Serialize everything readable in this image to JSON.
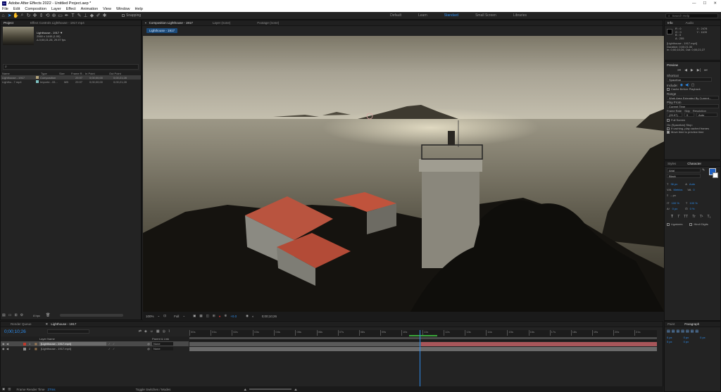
{
  "app": {
    "title": "Adobe After Effects 2022 - Untitled Project.aep *",
    "menu": [
      "File",
      "Edit",
      "Composition",
      "Layer",
      "Effect",
      "Animation",
      "View",
      "Window",
      "Help"
    ]
  },
  "toolbar": {
    "snapping_label": "Snapping",
    "workspaces": [
      "Default",
      "Learn",
      "Standard",
      "Small Screen",
      "Libraries"
    ],
    "active_workspace": "Standard",
    "search_placeholder": "Search Help"
  },
  "project": {
    "tab_label": "Project",
    "effect_controls_label": "Effect Controls Lighthouse - 1917.mp4",
    "preview_name": "Lighthouse - 1917 ▼",
    "preview_line1": "2560 x 1440 (1.00)",
    "preview_line2": "Δ 0;00;21;28, 29.97 fps",
    "columns": [
      "Name",
      "Type",
      "Size",
      "Frame R...",
      "In Point",
      "Out Point"
    ],
    "items": [
      {
        "name": "Lighthouse - 1917",
        "type": "Composition",
        "size": "",
        "fps": "29.97",
        "in": "0;00;00;00",
        "out": "0;00;21;28"
      },
      {
        "name": "Lightho...7.mp4",
        "type": "Importe...33...",
        "size": "MB",
        "fps": "29.97",
        "in": "0;00;00;00",
        "out": "0;00;21;28"
      }
    ],
    "bpc": "8 bpc"
  },
  "viewer": {
    "tabs": [
      {
        "label": "Composition Lighthouse - 1917",
        "active": true
      },
      {
        "label": "Layer (none)",
        "active": false
      },
      {
        "label": "Footage (none)",
        "active": false
      }
    ],
    "sub_tab": "Lighthouse - 1917",
    "zoom": "100%",
    "resolution": "Full",
    "exposure": "+0.0",
    "timecode": "0;00;10;26"
  },
  "info": {
    "tabs": [
      "Info",
      "Audio"
    ],
    "r": "R : 0",
    "g": "G : 0",
    "b": "B : 0",
    "a": "A : 255",
    "x": "X : 2478",
    "y": "Y : 1109",
    "layer_name": "[Lighthouse - 1917.mp4]",
    "duration": "Duration: 0;00;21;30",
    "inout": "In: 0;00;10;26, Out: 0;00;21;27"
  },
  "preview": {
    "title": "Preview",
    "shortcut_label": "Shortcut",
    "shortcut_value": "Spacebar",
    "include_label": "Include:",
    "cache_label": "Cache Before Playback",
    "range_label": "Range",
    "range_value": "Work Area Extended By Current...",
    "play_from_label": "Play From",
    "play_from_value": "Current Time",
    "frame_rate_label": "Frame Rate",
    "skip_label": "Skip",
    "resolution_label": "Resolution",
    "frame_rate_value": "(29.97)",
    "skip_value": "0",
    "resolution_value": "Auto",
    "full_screen_label": "Full Screen",
    "on_stop_label": "On (Spacebar) Stop:",
    "if_caching_label": "If caching, play cached frames",
    "move_time_label": "Move time to preview time"
  },
  "character": {
    "tabs": [
      "Styles",
      "Character"
    ],
    "font": "Arial",
    "style": "Black",
    "size": "36 px",
    "leading": "Auto",
    "kerning": "Metrics",
    "tracking": "0",
    "stroke": "– px",
    "vscale": "100 %",
    "hscale": "100 %",
    "baseline": "0 px",
    "tsume": "0 %",
    "styles": [
      "T",
      "T",
      "TT",
      "Tr",
      "T¹",
      "T₁"
    ],
    "ligatures": "Ligatures",
    "hindi": "Hindi Digits",
    "fill_color": "#1f5fbf"
  },
  "paragraph": {
    "tabs": [
      "Paint",
      "Paragraph"
    ],
    "l1": "0 px",
    "l2": "0 px",
    "l3": "0 px",
    "l4": "0 px",
    "l5": "0 px",
    "l6": "0 px"
  },
  "timeline": {
    "tabs": [
      "Render Queue",
      "Lighthouse - 1917"
    ],
    "timecode": "0;00;10;26",
    "search_placeholder": "",
    "col_layer": "Layer Name",
    "col_parent": "Parent & Link",
    "layers": [
      {
        "num": "1",
        "name": "[Lighthouse - 1917.mp4]",
        "parent": "None",
        "color": "#c0392b",
        "selected": true
      },
      {
        "num": "2",
        "name": "[Lighthouse - 1917.mp4]",
        "parent": "None",
        "color": "#8a8a8a",
        "selected": false
      }
    ],
    "ruler": [
      "00s",
      "01s",
      "02s",
      "03s",
      "04s",
      "05s",
      "06s",
      "07s",
      "08s",
      "09s",
      "10s",
      "11s",
      "12s",
      "13s",
      "14s",
      "15s",
      "16s",
      "17s",
      "18s",
      "19s",
      "20s",
      "21s"
    ],
    "playhead_s": 10.87,
    "duration_s": 21.93,
    "status_label": "Frame Render Time",
    "status_value": "27ms",
    "toggle_label": "Toggle Switches / Modes"
  }
}
